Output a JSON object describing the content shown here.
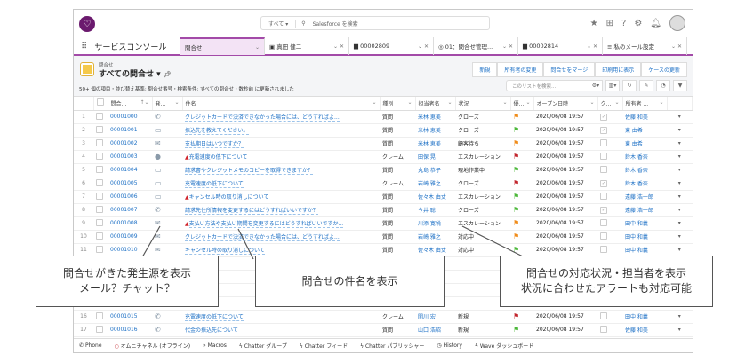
{
  "header": {
    "search_scope": "すべて ▾",
    "search_placeholder": "Salesforce を検索"
  },
  "app_name": "サービスコンソール",
  "tabs": [
    {
      "label": "問合せ",
      "icon": "none"
    },
    {
      "label": "真田 健二",
      "icon": "contact-icon"
    },
    {
      "label": "00002809",
      "icon": "case-icon"
    },
    {
      "label": "01：問合せ管理...",
      "icon": "dashboard-icon"
    },
    {
      "label": "00002814",
      "icon": "case-icon"
    },
    {
      "label": "私のメール設定",
      "icon": "list-icon"
    }
  ],
  "list": {
    "object": "問合せ",
    "title": "すべての問合せ",
    "meta": "50+ 個の項目・並び替え基準: 問合せ番号・検索条件: すべての問合せ・数秒前 に更新されました",
    "search_placeholder": "このリストを検索...",
    "actions": [
      "新規",
      "所有者の変更",
      "問合せをマージ",
      "印刷用に表示",
      "ケースの更新"
    ]
  },
  "columns": [
    "問合...",
    "発...",
    "件名",
    "種別",
    "担当者名",
    "状況",
    "優...",
    "オープン日時",
    "ク...",
    "所有者 ..."
  ],
  "rows": [
    {
      "n": "1",
      "id": "00001000",
      "origin": "phone",
      "subject": "クレジットカードで決済できなかった場合には、どうすればよ...",
      "alert": false,
      "type": "質問",
      "agent": "米林 恵美",
      "status": "クローズ",
      "flag": "#f08c1a",
      "date": "2020/06/08 19:57",
      "closed": true,
      "owner": "佐藤 和美"
    },
    {
      "n": "2",
      "id": "00001001",
      "origin": "web",
      "subject": "振込先を教えてください。",
      "alert": false,
      "type": "質問",
      "agent": "米林 恵美",
      "status": "クローズ",
      "flag": "#4cb83a",
      "date": "2020/06/08 19:57",
      "closed": true,
      "owner": "東 由希"
    },
    {
      "n": "3",
      "id": "00001002",
      "origin": "email",
      "subject": "支払期日はいつですか？",
      "alert": false,
      "type": "質問",
      "agent": "米林 恵美",
      "status": "顧客待ち",
      "flag": "#f08c1a",
      "date": "2020/06/08 19:57",
      "closed": false,
      "owner": "東 由希"
    },
    {
      "n": "4",
      "id": "00001003",
      "origin": "chat",
      "subject": "充電速度の低下について",
      "alert": true,
      "type": "クレーム",
      "agent": "田保 晃",
      "status": "エスカレーション",
      "flag": "#c2262d",
      "date": "2020/06/08 19:57",
      "closed": false,
      "owner": "鈴木 香奈"
    },
    {
      "n": "5",
      "id": "00001004",
      "origin": "web",
      "subject": "請求書やクレジットメモのコピーを取得できますか？",
      "alert": false,
      "type": "質問",
      "agent": "丸島 恭子",
      "status": "現地作業中",
      "flag": "#4cb83a",
      "date": "2020/06/08 19:57",
      "closed": false,
      "owner": "鈴木 香奈"
    },
    {
      "n": "6",
      "id": "00001005",
      "origin": "web",
      "subject": "充電速度の低下について",
      "alert": false,
      "type": "クレーム",
      "agent": "岩崎 雅之",
      "status": "クローズ",
      "flag": "#c2262d",
      "date": "2020/06/08 19:57",
      "closed": true,
      "owner": "鈴木 香奈"
    },
    {
      "n": "7",
      "id": "00001006",
      "origin": "web",
      "subject": "キャンセル時の取り消しについて",
      "alert": true,
      "type": "質問",
      "agent": "佐々木 由丈",
      "status": "エスカレーション",
      "flag": "#4cb83a",
      "date": "2020/06/08 19:57",
      "closed": false,
      "owner": "遠藤 浩一郎"
    },
    {
      "n": "8",
      "id": "00001007",
      "origin": "phone",
      "subject": "請求先住所情報を変更するにはどうすればいいですか？",
      "alert": false,
      "type": "質問",
      "agent": "今井 聡",
      "status": "クローズ",
      "flag": "#4cb83a",
      "date": "2020/06/08 19:57",
      "closed": true,
      "owner": "遠藤 浩一郎"
    },
    {
      "n": "9",
      "id": "00001008",
      "origin": "email",
      "subject": "支払い方法や支払い期間を変更するにはどうすればいいですか...",
      "alert": true,
      "type": "質問",
      "agent": "川添 寛税",
      "status": "エスカレーション",
      "flag": "#f08c1a",
      "date": "2020/06/08 19:57",
      "closed": false,
      "owner": "田中 和義"
    },
    {
      "n": "10",
      "id": "00001009",
      "origin": "email",
      "subject": "クレジットカードで決済できなかった場合には、どうすればよ...",
      "alert": false,
      "type": "質問",
      "agent": "岩崎 雅之",
      "status": "対応中",
      "flag": "#f08c1a",
      "date": "2020/06/08 19:57",
      "closed": false,
      "owner": "田中 和義"
    },
    {
      "n": "11",
      "id": "00001010",
      "origin": "email",
      "subject": "キャンセル時の取り消しについて",
      "alert": false,
      "type": "質問",
      "agent": "佐々木 由丈",
      "status": "対応中",
      "flag": "#4cb83a",
      "date": "2020/06/08 19:57",
      "closed": false,
      "owner": "田中 和義"
    },
    {
      "n": "16",
      "id": "00001015",
      "origin": "phone",
      "subject": "充電速度の低下について",
      "alert": false,
      "type": "クレーム",
      "agent": "関川 宏",
      "status": "新規",
      "flag": "#c2262d",
      "date": "2020/06/08 19:57",
      "closed": false,
      "owner": "田中 和義"
    },
    {
      "n": "17",
      "id": "00001016",
      "origin": "phone",
      "subject": "代金の振込先について",
      "alert": false,
      "type": "質問",
      "agent": "山口 浩昭",
      "status": "新規",
      "flag": "#4cb83a",
      "date": "2020/06/08 19:57",
      "closed": false,
      "owner": "佐藤 和美"
    }
  ],
  "footer": [
    "Phone",
    "オムニチャネル (オフライン)",
    "Macros",
    "Chatter グループ",
    "Chatter フィード",
    "Chatter パブリッシャー",
    "History",
    "Wave ダッシュボード"
  ],
  "callouts": {
    "origin": [
      "問合せがきた発生源を表示",
      "メール？チャット？"
    ],
    "subject": "問合せの件名を表示",
    "status": [
      "問合せの対応状況・担当者を表示",
      "状況に合わせたアラートも対応可能"
    ]
  }
}
